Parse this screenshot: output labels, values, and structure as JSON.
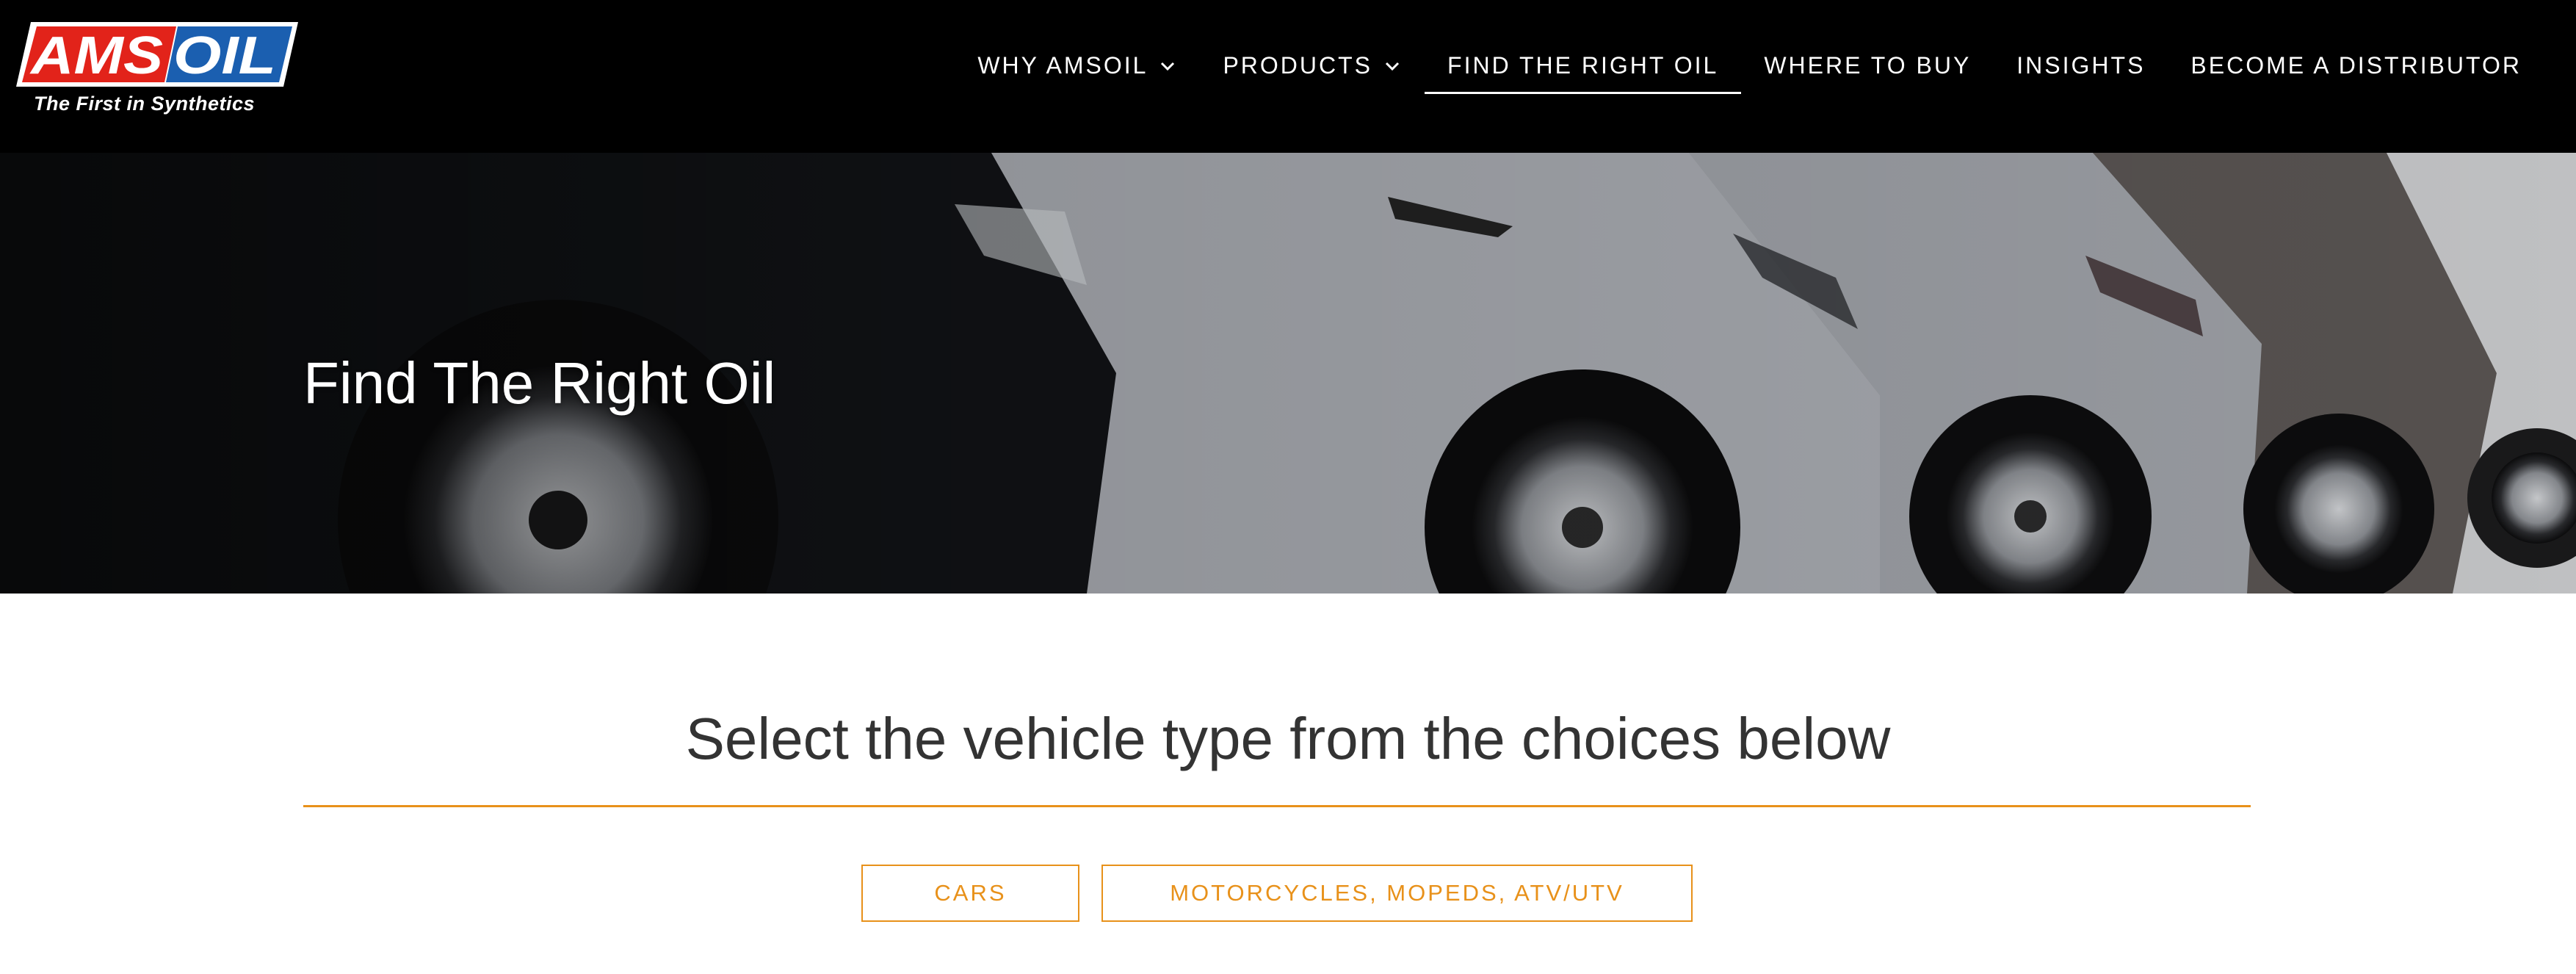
{
  "brand": {
    "logo_text": "AMSOIL",
    "tagline": "The First in Synthetics",
    "colors": {
      "red": "#e2231a",
      "blue": "#1b5fb0",
      "accent": "#e8911a",
      "header_bg": "#000000"
    }
  },
  "nav": {
    "items": [
      {
        "label": "WHY AMSOIL",
        "has_dropdown": true,
        "icon": "chevron-down-icon"
      },
      {
        "label": "PRODUCTS",
        "has_dropdown": true,
        "icon": "chevron-down-icon"
      },
      {
        "label": "FIND THE RIGHT OIL",
        "active": true
      },
      {
        "label": "WHERE TO BUY"
      },
      {
        "label": "INSIGHTS"
      },
      {
        "label": "BECOME A DISTRIBUTOR"
      }
    ]
  },
  "hero": {
    "title": "Find The Right Oil"
  },
  "main": {
    "subtitle": "Select the vehicle type from the choices below",
    "choices": [
      {
        "label": "CARS"
      },
      {
        "label": "MOTORCYCLES, MOPEDS, ATV/UTV"
      }
    ]
  }
}
